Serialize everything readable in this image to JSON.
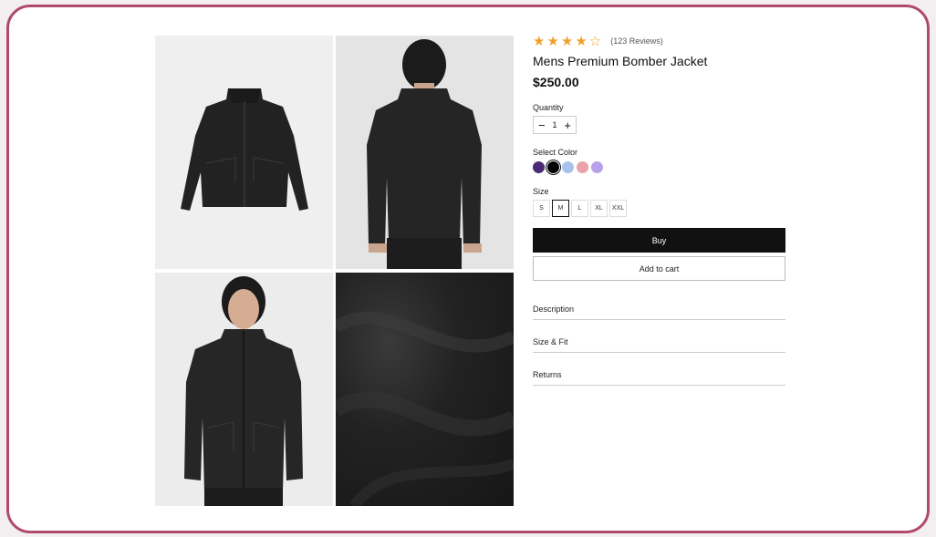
{
  "product": {
    "rating_stars": "★★★★☆",
    "rating_value": 4,
    "reviews": "(123 Reviews)",
    "title": "Mens Premium Bomber Jacket",
    "price": "$250.00"
  },
  "quantity": {
    "label": "Quantity",
    "value": "1",
    "minus": "−",
    "plus": "+"
  },
  "color": {
    "label": "Select Color",
    "swatches": [
      "#4b2a73",
      "#000000",
      "#a8c2ec",
      "#e9a3a8",
      "#b9a0ea"
    ],
    "selected_index": 1
  },
  "size": {
    "label": "Size",
    "options": [
      "S",
      "M",
      "L",
      "XL",
      "XXL"
    ],
    "selected": "M"
  },
  "actions": {
    "buy": "Buy",
    "add_to_cart": "Add to cart"
  },
  "accordion": [
    "Description",
    "Size & Fit",
    "Returns"
  ],
  "images": [
    "jacket-front-flatlay",
    "jacket-back-model",
    "jacket-front-model",
    "fabric-closeup"
  ]
}
